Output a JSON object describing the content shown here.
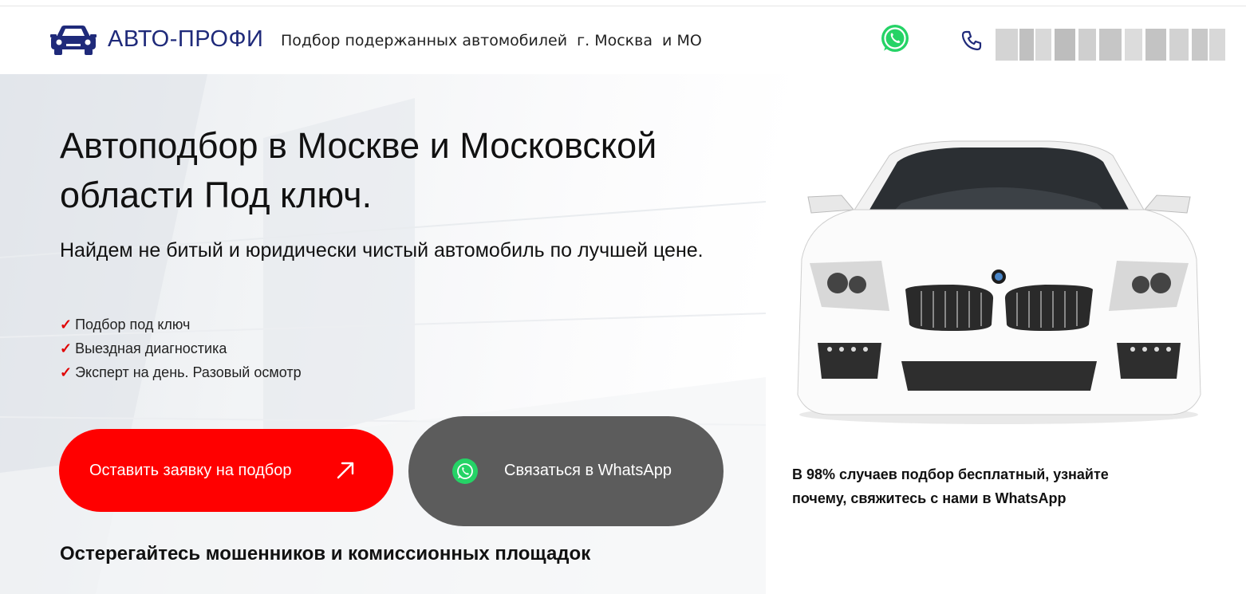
{
  "header": {
    "brand": "АВТО-ПРОФИ",
    "tagline": "Подбор подержанных автомобилей  г. Москва  и МО",
    "logo_icon": "car-front-icon",
    "whatsapp_icon": "whatsapp-icon",
    "phone_icon": "phone-icon"
  },
  "hero": {
    "title": "Автоподбор в Москве и Московской области Под ключ.",
    "subtitle": "Найдем не битый и юридически чистый автомобиль по лучшей цене.",
    "features": [
      "Подбор под ключ",
      "Выездная диагностика",
      "Эксперт на день. Разовый осмотр"
    ],
    "request_button": "Оставить заявку на подбор",
    "whatsapp_button": "Связаться в WhatsApp",
    "warning": "Остерегайтесь мошенников и комиссионных площадок",
    "note": "В 98% случаев подбор бесплатный, узнайте почему, свяжитесь с нами в WhatsApp"
  },
  "colors": {
    "brand": "#1f2a7a",
    "accent_red": "#ff0000",
    "whatsapp_green": "#25d366",
    "button_gray": "#5c5c5c",
    "check_red": "#e00000"
  }
}
